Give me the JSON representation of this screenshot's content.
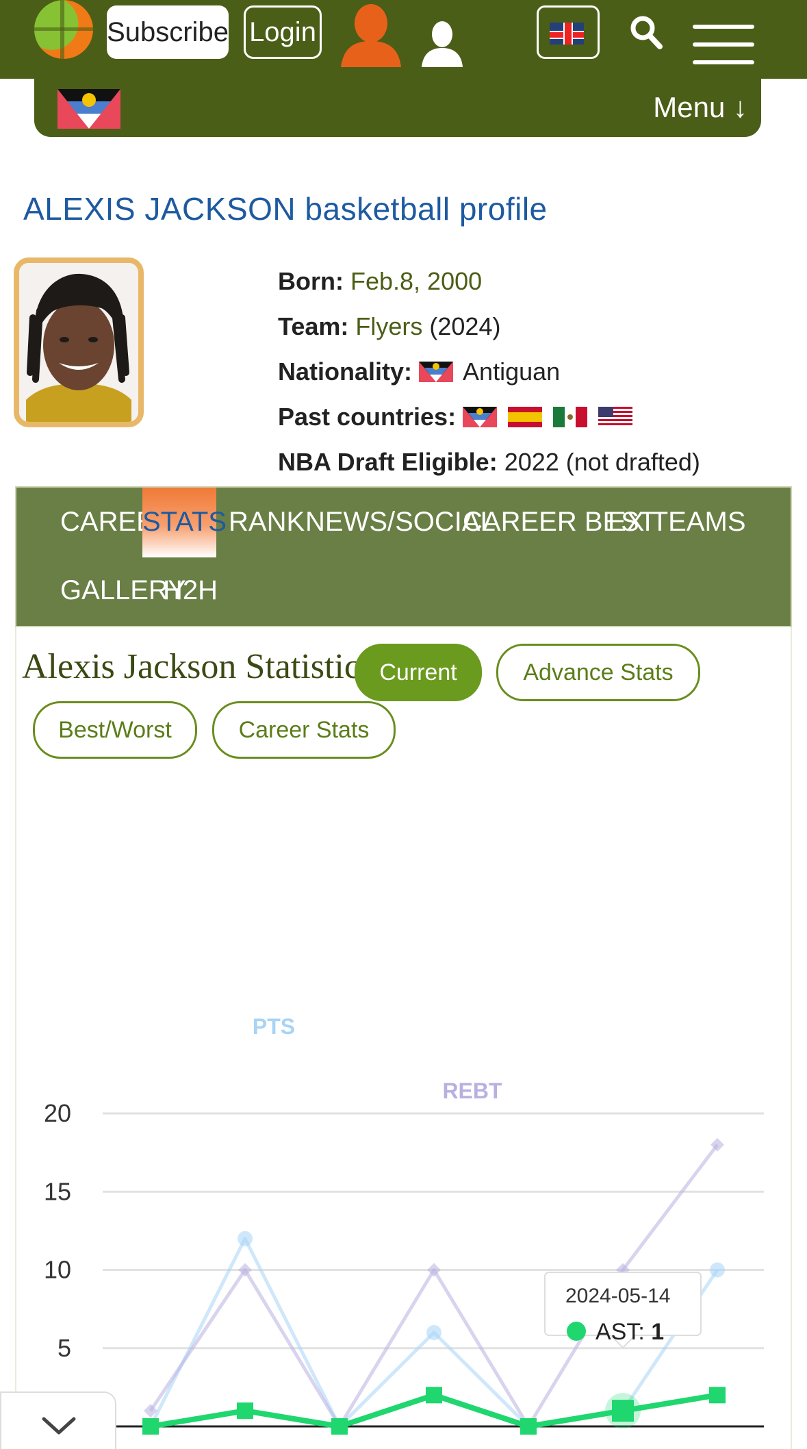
{
  "header": {
    "subscribe_label": "Subscribe",
    "login_label": "Login",
    "menu_label": "Menu ↓"
  },
  "profile": {
    "title": "ALEXIS JACKSON basketball profile",
    "born_label": "Born:",
    "born_value": "Feb.8, 2000",
    "team_label": "Team:",
    "team_value": "Flyers",
    "team_year": "(2024)",
    "nationality_label": "Nationality:",
    "nationality_value": "Antiguan",
    "past_label": "Past countries:",
    "draft_label": "NBA Draft Eligible:",
    "draft_value": "2022 (not drafted)"
  },
  "tabs": [
    "CAREER",
    "STATS",
    "RANK",
    "NEWS/SOCIAL",
    "CAREER BEST",
    "EX TEAMS",
    "GALLERY",
    "H2H"
  ],
  "active_tab": "STATS",
  "stats": {
    "heading": "Alexis Jackson Statistics",
    "pills": [
      "Current",
      "Advance Stats",
      "Best/Worst",
      "Career Stats"
    ],
    "active_pill": "Current"
  },
  "colors": {
    "header_green": "#4b5e17",
    "accent_orange": "#f07a16",
    "link_blue": "#1e5aa0",
    "pts": "#a8d4f5",
    "rebt": "#b8b0e0",
    "ast": "#1fd66f"
  },
  "chart_data": {
    "type": "line",
    "ylim": [
      0,
      20
    ],
    "y_ticks": [
      5,
      10,
      15,
      20
    ],
    "series": [
      {
        "name": "PTS",
        "values": [
          0,
          12,
          0,
          6,
          0,
          1,
          10
        ]
      },
      {
        "name": "REBT",
        "values": [
          1,
          10,
          0,
          10,
          0,
          10,
          18
        ]
      },
      {
        "name": "AST",
        "values": [
          0,
          1,
          0,
          2,
          0,
          1,
          2
        ]
      }
    ],
    "tooltip": {
      "date": "2024-05-14",
      "series": "AST",
      "value": "1"
    }
  }
}
